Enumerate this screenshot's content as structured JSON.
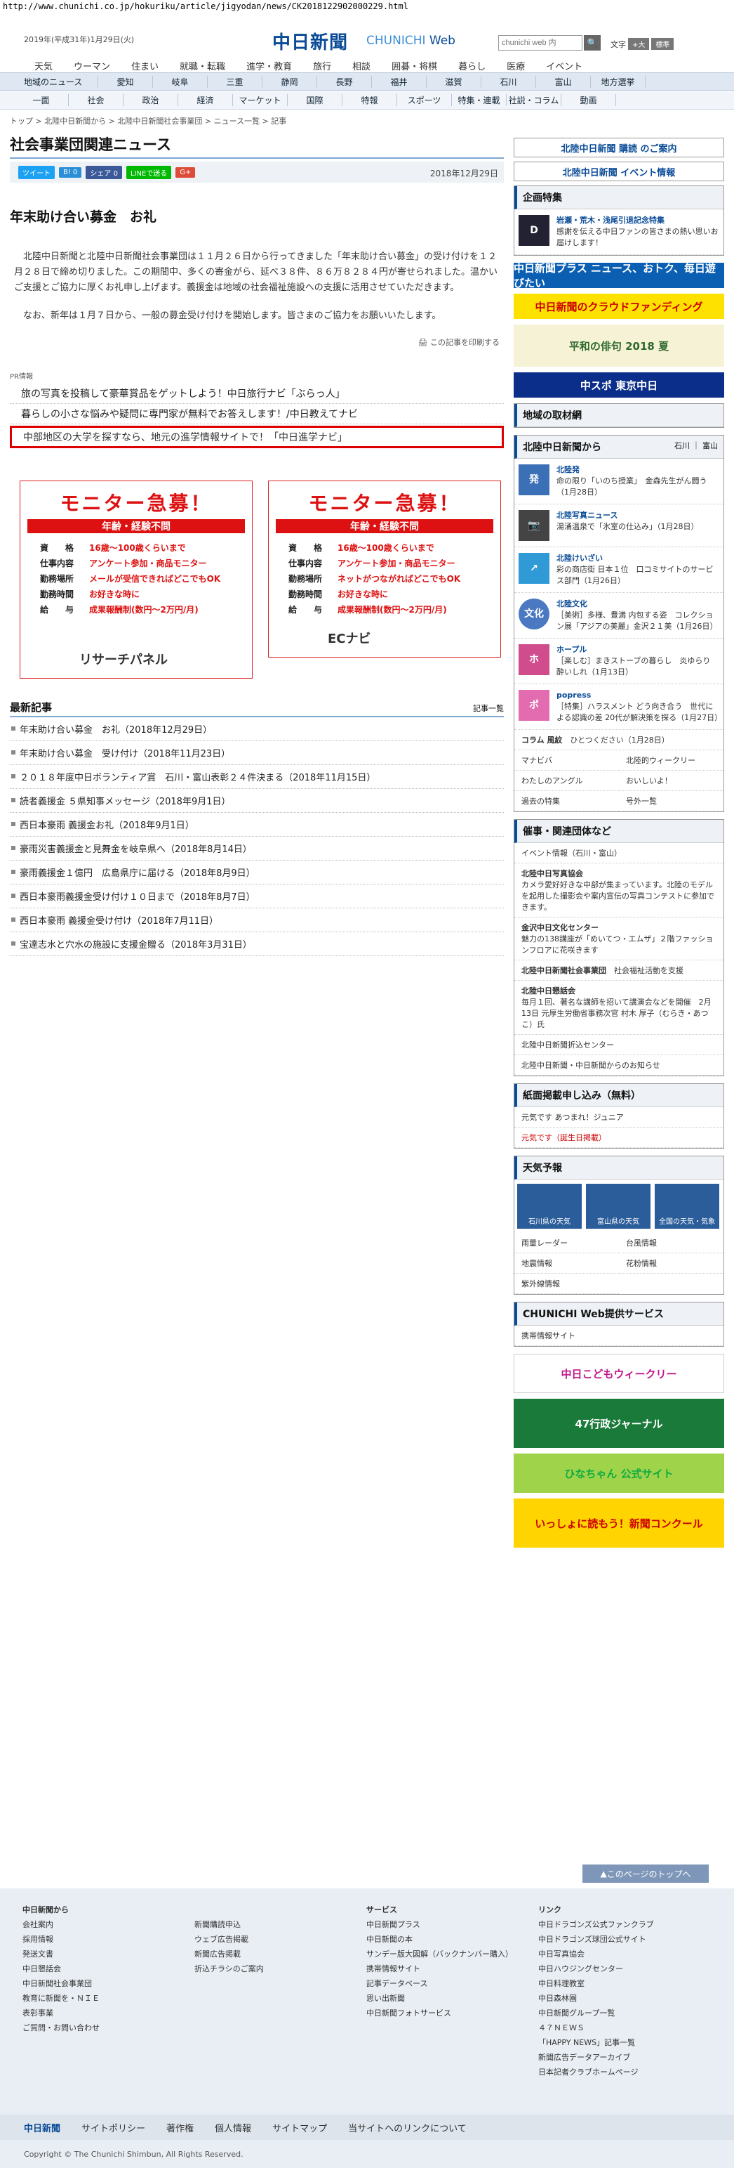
{
  "url": "http://www.chunichi.co.jp/hokuriku/article/jigyodan/news/CK2018122902000229.html",
  "header": {
    "date": "2019年(平成31年)1月29日(火)",
    "logo_jp": "中日新聞",
    "logo_en1": "CHUNICHI",
    "logo_en2": " Web",
    "search_placeholder": "chunichi web 内",
    "search_btn": "🔍",
    "font_label": "文字",
    "font_large": "+大",
    "font_std": "標準",
    "top_nav": [
      "天気",
      "ウーマン",
      "住まい",
      "就職・転職",
      "進学・教育",
      "旅行",
      "相談",
      "囲碁・将棋",
      "暮らし",
      "医療",
      "イベント"
    ]
  },
  "nav1": [
    "地域のニュース",
    "愛知",
    "岐阜",
    "三重",
    "静岡",
    "長野",
    "福井",
    "滋賀",
    "石川",
    "富山",
    "地方選挙"
  ],
  "nav2": [
    "一面",
    "社会",
    "政治",
    "経済",
    "マーケット",
    "国際",
    "特報",
    "スポーツ",
    "特集・連載",
    "社説・コラム",
    "動画"
  ],
  "breadcrumb": "トップ > 北陸中日新聞から > 北陸中日新聞社会事業団 > ニュース一覧 > 記事",
  "page_title": "社会事業団関連ニュース",
  "share": {
    "tweet": "ツイート",
    "hatena": "B! 0",
    "fb": "シェア 0",
    "line": "LINEで送る",
    "gplus": "G+",
    "date": "2018年12月29日"
  },
  "article": {
    "title": "年末助け合い募金　お礼",
    "p1": "北陸中日新聞と北陸中日新聞社会事業団は１１月２６日から行ってきました「年末助け合い募金」の受け付けを１２月２８日で締め切りました。この期間中、多くの寄金がら、延べ３８件、８６万８２８４円が寄せられました。温かいご支援とご協力に厚くお礼申し上げます。義援金は地域の社会福祉施設への支援に活用させていただきます。",
    "p2": "なお、新年は１月７日から、一般の募金受け付けを開始します。皆さまのご協力をお願いいたします。",
    "print": "この記事を印刷する"
  },
  "pr": {
    "label": "PR情報",
    "items": [
      "旅の写真を投稿して豪華賞品をゲットしよう！中日旅行ナビ「ぶらっ人」",
      "暮らしの小さな悩みや疑問に専門家が無料でお答えします！/中日教えてナビ"
    ],
    "highlight": "中部地区の大学を探すなら、地元の進学情報サイトで！「中日進学ナビ」"
  },
  "ads": [
    {
      "title": "モニター急募！",
      "bar": "年齢・経験不問",
      "rows": [
        [
          "資　　格",
          "16歳～100歳くらいまで"
        ],
        [
          "仕事内容",
          "アンケート参加・商品モニター"
        ],
        [
          "勤務場所",
          "メールが受信できればどこでもOK"
        ],
        [
          "勤務時間",
          "お好きな時に"
        ],
        [
          "給　　与",
          "成果報酬制(数円～2万円/月)"
        ]
      ],
      "logo": "リサーチパネル"
    },
    {
      "title": "モニター急募！",
      "bar": "年齢・経験不問",
      "rows": [
        [
          "資　　格",
          "16歳～100歳くらいまで"
        ],
        [
          "仕事内容",
          "アンケート参加・商品モニター"
        ],
        [
          "勤務場所",
          "ネットがつながればどこでもOK"
        ],
        [
          "勤務時間",
          "お好きな時に"
        ],
        [
          "給　　与",
          "成果報酬制(数円～2万円/月)"
        ]
      ],
      "logo": "ECナビ"
    }
  ],
  "latest": {
    "title": "最新記事",
    "all": "記事一覧",
    "items": [
      "年末助け合い募金　お礼（2018年12月29日）",
      "年末助け合い募金　受け付け（2018年11月23日）",
      "２０１８年度中日ボランティア賞　石川・富山表彰２４件決まる（2018年11月15日）",
      "読者義援金 ５県知事メッセージ（2018年9月1日）",
      "西日本豪雨 義援金お礼（2018年9月1日）",
      "豪雨災害義援金と見舞金を岐阜県へ（2018年8月14日）",
      "豪雨義援金１億円　広島県庁に届ける（2018年8月9日）",
      "西日本豪雨義援金受け付け１０日まで（2018年8月7日）",
      "西日本豪雨 義援金受け付け（2018年7月11日）",
      "宝達志水と穴水の施設に支援金贈る（2018年3月31日）"
    ]
  },
  "side": {
    "subscribe": "北陸中日新聞 購読 のご案内",
    "event": "北陸中日新聞 イベント情報",
    "kikaku": "企画特集",
    "kikaku_t": "岩瀬・荒木・浅尾引退記念特集",
    "kikaku_d": "感謝を伝える中日ファンの皆さまの熱い思いお届けします！",
    "b1": "中日新聞プラス ニュース、おトク、毎日遊びたい",
    "b2": "中日新聞のクラウドファンディング",
    "b3": "平和の俳句 2018 夏",
    "b4": "中スポ 東京中日",
    "region": "地域の取材網",
    "hokuriku": "北陸中日新聞から",
    "tabs": "石川 ｜ 富山",
    "feeds": [
      {
        "t": "北陸発",
        "d": "命の限り「いのち授業」　金森先生がん闘う（1月28日）",
        "c": "#3b6fb6",
        "i": "発"
      },
      {
        "t": "北陸写真ニュース",
        "d": "湯涌温泉で「氷室の仕込み」（1月28日）",
        "c": "#444",
        "i": "📷"
      },
      {
        "t": "北陸けいざい",
        "d": "彩の商店街 日本１位　口コミサイトのサービス部門（1月26日）",
        "c": "#2f9ad6",
        "i": "↗"
      },
      {
        "t": "北陸文化",
        "d": "［美術］多様、豊満 内包する姿　コレクション展「アジアの美麗」金沢２１美（1月26日）",
        "c": "#4a79c2",
        "i": "文化"
      },
      {
        "t": "ホープル",
        "d": "［楽しむ］まきストーブの暮らし　炎ゆらり 酔いしれ（1月13日）",
        "c": "#d14c8c",
        "i": "ホ"
      },
      {
        "t": "popress",
        "d": "［特集］ハラスメント どう向き合う　世代による認識の差 20代が解決策を探る（1月27日）",
        "c": "#e36cb0",
        "i": "ポ"
      }
    ],
    "column": "コラム 風紋",
    "column_d": "ひとつください（1月28日）",
    "links": [
      "マナビバ",
      "北陸的ウィークリー",
      "わたしのアングル",
      "おいしいよ！",
      "過去の特集",
      "号外一覧"
    ],
    "events": "催事・関連団体など",
    "event_list": "イベント情報（石川・富山）",
    "groups": [
      {
        "t": "北陸中日写真協会",
        "d": "カメラ愛好好きな中部が集まっています。北陸のモデルを起用した撮影会や案内宣伝の写真コンテストに参加できます。"
      },
      {
        "t": "金沢中日文化センター",
        "d": "魅力の138講座が「めいてつ・エムザ」２階ファッションフロアに花咲きます"
      },
      {
        "t": "北陸中日新聞社会事業団",
        "d": "社会福祉活動を支援"
      },
      {
        "t": "北陸中日懇話会",
        "d": "毎月１回、著名な講師を招いて講演会などを開催　2月13日 元厚生労働省事務次官 村木 厚子（むらき・あつこ）氏"
      }
    ],
    "rows2": [
      "北陸中日新聞折込センター",
      "北陸中日新聞・中日新聞からのお知らせ"
    ],
    "apply": "紙面掲載申し込み（無料）",
    "apply1": "元気です あつまれ！ジュニア",
    "apply2": "元気です（誕生日掲載）",
    "weather": "天気予報",
    "wx": [
      "石川県の天気",
      "富山県の天気",
      "全国の天気・気象"
    ],
    "wxlinks": [
      "雨量レーダー",
      "台風情報",
      "地震情報",
      "花粉情報",
      "紫外線情報"
    ],
    "svc": "CHUNICHI Web提供サービス",
    "svc1": "携帯情報サイト",
    "b5": "中日こどもウィークリー",
    "b6": "47行政ジャーナル",
    "b7": "ひなちゃん 公式サイト",
    "b8": "いっしょに読もう！新聞コンクール"
  },
  "totop": "このページのトップへ",
  "footer": {
    "cols": [
      {
        "h": "中日新聞から",
        "items": [
          "会社案内",
          "採用情報",
          "発送文書",
          "中日懇話会",
          "中日新聞社会事業団",
          "教育に新聞を・ＮＩＥ",
          "表彰事業",
          "ご質問・お問い合わせ"
        ]
      },
      {
        "h": "",
        "items": [
          "新聞購読申込",
          "ウェブ広告掲載",
          "新聞広告掲載",
          "折込チラシのご案内"
        ]
      },
      {
        "h": "サービス",
        "items": [
          "中日新聞プラス",
          "中日新聞の本",
          "サンデー版大図解（バックナンバー購入）",
          "携帯情報サイト",
          "記事データベース",
          "思い出新聞",
          "中日新聞フォトサービス"
        ]
      },
      {
        "h": "リンク",
        "items": [
          "中日ドラゴンズ公式ファンクラブ",
          "中日ドラゴンズ球団公式サイト",
          "中日写真協会",
          "中日ハウジングセンター",
          "中日料理教室",
          "中日森林園",
          "中日新聞グループ一覧",
          "４７ＮＥＷＳ",
          "「HAPPY NEWS」記事一覧",
          "新聞広告データアーカイブ",
          "日本記者クラブホームページ"
        ]
      }
    ],
    "bar": [
      "中日新聞",
      "サイトポリシー",
      "著作権",
      "個人情報",
      "サイトマップ",
      "当サイトへのリンクについて"
    ],
    "copyright": "Copyright © The Chunichi Shimbun, All Rights Reserved."
  }
}
